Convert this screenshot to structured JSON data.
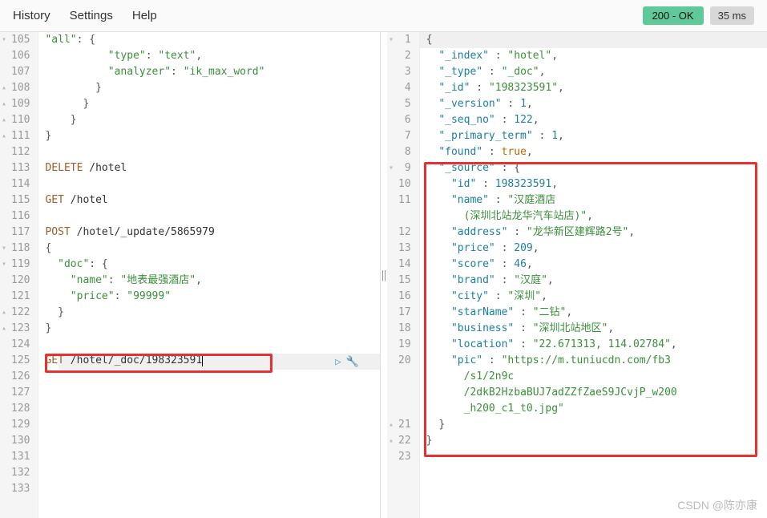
{
  "menu": {
    "history": "History",
    "settings": "Settings",
    "help": "Help"
  },
  "status": {
    "code": "200 - OK",
    "time": "35 ms"
  },
  "left": {
    "lines": [
      {
        "n": "105",
        "fold": "▾",
        "t": "        \"all\": {",
        "tokens": [
          {
            "c": "str",
            "t": "\"all\""
          },
          {
            "c": "punc",
            "t": ": {"
          }
        ]
      },
      {
        "n": "106",
        "t": "          \"type\": \"text\",",
        "tokens": [
          {
            "c": "",
            "t": "          "
          },
          {
            "c": "str",
            "t": "\"type\""
          },
          {
            "c": "punc",
            "t": ": "
          },
          {
            "c": "str",
            "t": "\"text\""
          },
          {
            "c": "punc",
            "t": ","
          }
        ]
      },
      {
        "n": "107",
        "t": "          \"analyzer\": \"ik_max_word\"",
        "tokens": [
          {
            "c": "",
            "t": "          "
          },
          {
            "c": "str",
            "t": "\"analyzer\""
          },
          {
            "c": "punc",
            "t": ": "
          },
          {
            "c": "str",
            "t": "\"ik_max_word\""
          }
        ]
      },
      {
        "n": "108",
        "fold": "▴",
        "t": "        }",
        "tokens": [
          {
            "c": "",
            "t": "        "
          },
          {
            "c": "punc",
            "t": "}"
          }
        ]
      },
      {
        "n": "109",
        "fold": "▴",
        "t": "      }",
        "tokens": [
          {
            "c": "",
            "t": "      "
          },
          {
            "c": "punc",
            "t": "}"
          }
        ]
      },
      {
        "n": "110",
        "fold": "▴",
        "t": "    }",
        "tokens": [
          {
            "c": "",
            "t": "    "
          },
          {
            "c": "punc",
            "t": "}"
          }
        ]
      },
      {
        "n": "111",
        "fold": "▴",
        "t": "}",
        "tokens": [
          {
            "c": "punc",
            "t": "}"
          }
        ]
      },
      {
        "n": "112",
        "t": "",
        "tokens": []
      },
      {
        "n": "113",
        "t": "DELETE /hotel",
        "tokens": [
          {
            "c": "kw",
            "t": "DELETE"
          },
          {
            "c": "",
            "t": " /hotel"
          }
        ]
      },
      {
        "n": "114",
        "t": "",
        "tokens": []
      },
      {
        "n": "115",
        "t": "GET /hotel",
        "tokens": [
          {
            "c": "kw",
            "t": "GET"
          },
          {
            "c": "",
            "t": " /hotel"
          }
        ]
      },
      {
        "n": "116",
        "t": "",
        "tokens": []
      },
      {
        "n": "117",
        "t": "POST /hotel/_update/5865979",
        "tokens": [
          {
            "c": "kw",
            "t": "POST"
          },
          {
            "c": "",
            "t": " /hotel/_update/5865979"
          }
        ]
      },
      {
        "n": "118",
        "fold": "▾",
        "t": "{",
        "tokens": [
          {
            "c": "punc",
            "t": "{"
          }
        ]
      },
      {
        "n": "119",
        "fold": "▾",
        "t": "  \"doc\": {",
        "tokens": [
          {
            "c": "",
            "t": "  "
          },
          {
            "c": "str",
            "t": "\"doc\""
          },
          {
            "c": "punc",
            "t": ": {"
          }
        ]
      },
      {
        "n": "120",
        "t": "    \"name\": \"地表最强酒店\",",
        "tokens": [
          {
            "c": "",
            "t": "    "
          },
          {
            "c": "str",
            "t": "\"name\""
          },
          {
            "c": "punc",
            "t": ": "
          },
          {
            "c": "str",
            "t": "\"地表最强酒店\""
          },
          {
            "c": "punc",
            "t": ","
          }
        ]
      },
      {
        "n": "121",
        "t": "    \"price\": \"99999\"",
        "tokens": [
          {
            "c": "",
            "t": "    "
          },
          {
            "c": "str",
            "t": "\"price\""
          },
          {
            "c": "punc",
            "t": ": "
          },
          {
            "c": "str",
            "t": "\"99999\""
          }
        ]
      },
      {
        "n": "122",
        "fold": "▴",
        "t": "  }",
        "tokens": [
          {
            "c": "",
            "t": "  "
          },
          {
            "c": "punc",
            "t": "}"
          }
        ]
      },
      {
        "n": "123",
        "fold": "▴",
        "t": "}",
        "tokens": [
          {
            "c": "punc",
            "t": "}"
          }
        ]
      },
      {
        "n": "124",
        "t": "",
        "tokens": []
      },
      {
        "n": "125",
        "t": "GET /hotel/_doc/198323591",
        "tokens": [
          {
            "c": "kw",
            "t": "GET"
          },
          {
            "c": "",
            "t": " /hotel/_doc/198323591"
          }
        ],
        "cursor": true
      },
      {
        "n": "126",
        "t": "",
        "tokens": []
      },
      {
        "n": "127",
        "t": "",
        "tokens": []
      },
      {
        "n": "128",
        "t": "",
        "tokens": []
      },
      {
        "n": "129",
        "t": "",
        "tokens": []
      },
      {
        "n": "130",
        "t": "",
        "tokens": []
      },
      {
        "n": "131",
        "t": "",
        "tokens": []
      },
      {
        "n": "132",
        "t": "",
        "tokens": []
      },
      {
        "n": "133",
        "t": "",
        "tokens": []
      }
    ]
  },
  "right": {
    "lines": [
      {
        "n": "1",
        "fold": "▾",
        "tokens": [
          {
            "c": "punc",
            "t": "{"
          }
        ]
      },
      {
        "n": "2",
        "tokens": [
          {
            "c": "",
            "t": "  "
          },
          {
            "c": "key",
            "t": "\"_index\""
          },
          {
            "c": "punc",
            "t": " : "
          },
          {
            "c": "str",
            "t": "\"hotel\""
          },
          {
            "c": "punc",
            "t": ","
          }
        ]
      },
      {
        "n": "3",
        "tokens": [
          {
            "c": "",
            "t": "  "
          },
          {
            "c": "key",
            "t": "\"_type\""
          },
          {
            "c": "punc",
            "t": " : "
          },
          {
            "c": "str",
            "t": "\"_doc\""
          },
          {
            "c": "punc",
            "t": ","
          }
        ]
      },
      {
        "n": "4",
        "tokens": [
          {
            "c": "",
            "t": "  "
          },
          {
            "c": "key",
            "t": "\"_id\""
          },
          {
            "c": "punc",
            "t": " : "
          },
          {
            "c": "str",
            "t": "\"198323591\""
          },
          {
            "c": "punc",
            "t": ","
          }
        ]
      },
      {
        "n": "5",
        "tokens": [
          {
            "c": "",
            "t": "  "
          },
          {
            "c": "key",
            "t": "\"_version\""
          },
          {
            "c": "punc",
            "t": " : "
          },
          {
            "c": "num",
            "t": "1"
          },
          {
            "c": "punc",
            "t": ","
          }
        ]
      },
      {
        "n": "6",
        "tokens": [
          {
            "c": "",
            "t": "  "
          },
          {
            "c": "key",
            "t": "\"_seq_no\""
          },
          {
            "c": "punc",
            "t": " : "
          },
          {
            "c": "num",
            "t": "122"
          },
          {
            "c": "punc",
            "t": ","
          }
        ]
      },
      {
        "n": "7",
        "tokens": [
          {
            "c": "",
            "t": "  "
          },
          {
            "c": "key",
            "t": "\"_primary_term\""
          },
          {
            "c": "punc",
            "t": " : "
          },
          {
            "c": "num",
            "t": "1"
          },
          {
            "c": "punc",
            "t": ","
          }
        ]
      },
      {
        "n": "8",
        "tokens": [
          {
            "c": "",
            "t": "  "
          },
          {
            "c": "key",
            "t": "\"found\""
          },
          {
            "c": "punc",
            "t": " : "
          },
          {
            "c": "bool",
            "t": "true"
          },
          {
            "c": "punc",
            "t": ","
          }
        ]
      },
      {
        "n": "9",
        "fold": "▾",
        "tokens": [
          {
            "c": "",
            "t": "  "
          },
          {
            "c": "key",
            "t": "\"_source\""
          },
          {
            "c": "punc",
            "t": " : {"
          }
        ]
      },
      {
        "n": "10",
        "tokens": [
          {
            "c": "",
            "t": "    "
          },
          {
            "c": "key",
            "t": "\"id\""
          },
          {
            "c": "punc",
            "t": " : "
          },
          {
            "c": "num",
            "t": "198323591"
          },
          {
            "c": "punc",
            "t": ","
          }
        ]
      },
      {
        "n": "11",
        "tokens": [
          {
            "c": "",
            "t": "    "
          },
          {
            "c": "key",
            "t": "\"name\""
          },
          {
            "c": "punc",
            "t": " : "
          },
          {
            "c": "str",
            "t": "\"汉庭酒店"
          }
        ]
      },
      {
        "n": "",
        "tokens": [
          {
            "c": "",
            "t": "      "
          },
          {
            "c": "str",
            "t": "(深圳北站龙华汽车站店)\""
          },
          {
            "c": "punc",
            "t": ","
          }
        ]
      },
      {
        "n": "12",
        "tokens": [
          {
            "c": "",
            "t": "    "
          },
          {
            "c": "key",
            "t": "\"address\""
          },
          {
            "c": "punc",
            "t": " : "
          },
          {
            "c": "str",
            "t": "\"龙华新区建辉路2号\""
          },
          {
            "c": "punc",
            "t": ","
          }
        ]
      },
      {
        "n": "13",
        "tokens": [
          {
            "c": "",
            "t": "    "
          },
          {
            "c": "key",
            "t": "\"price\""
          },
          {
            "c": "punc",
            "t": " : "
          },
          {
            "c": "num",
            "t": "209"
          },
          {
            "c": "punc",
            "t": ","
          }
        ]
      },
      {
        "n": "14",
        "tokens": [
          {
            "c": "",
            "t": "    "
          },
          {
            "c": "key",
            "t": "\"score\""
          },
          {
            "c": "punc",
            "t": " : "
          },
          {
            "c": "num",
            "t": "46"
          },
          {
            "c": "punc",
            "t": ","
          }
        ]
      },
      {
        "n": "15",
        "tokens": [
          {
            "c": "",
            "t": "    "
          },
          {
            "c": "key",
            "t": "\"brand\""
          },
          {
            "c": "punc",
            "t": " : "
          },
          {
            "c": "str",
            "t": "\"汉庭\""
          },
          {
            "c": "punc",
            "t": ","
          }
        ]
      },
      {
        "n": "16",
        "tokens": [
          {
            "c": "",
            "t": "    "
          },
          {
            "c": "key",
            "t": "\"city\""
          },
          {
            "c": "punc",
            "t": " : "
          },
          {
            "c": "str",
            "t": "\"深圳\""
          },
          {
            "c": "punc",
            "t": ","
          }
        ]
      },
      {
        "n": "17",
        "tokens": [
          {
            "c": "",
            "t": "    "
          },
          {
            "c": "key",
            "t": "\"starName\""
          },
          {
            "c": "punc",
            "t": " : "
          },
          {
            "c": "str",
            "t": "\"二钻\""
          },
          {
            "c": "punc",
            "t": ","
          }
        ]
      },
      {
        "n": "18",
        "tokens": [
          {
            "c": "",
            "t": "    "
          },
          {
            "c": "key",
            "t": "\"business\""
          },
          {
            "c": "punc",
            "t": " : "
          },
          {
            "c": "str",
            "t": "\"深圳北站地区\""
          },
          {
            "c": "punc",
            "t": ","
          }
        ]
      },
      {
        "n": "19",
        "tokens": [
          {
            "c": "",
            "t": "    "
          },
          {
            "c": "key",
            "t": "\"location\""
          },
          {
            "c": "punc",
            "t": " : "
          },
          {
            "c": "str",
            "t": "\"22.671313, 114.02784\""
          },
          {
            "c": "punc",
            "t": ","
          }
        ]
      },
      {
        "n": "20",
        "tokens": [
          {
            "c": "",
            "t": "    "
          },
          {
            "c": "key",
            "t": "\"pic\""
          },
          {
            "c": "punc",
            "t": " : "
          },
          {
            "c": "str",
            "t": "\"https://m.tuniucdn.com/fb3"
          }
        ]
      },
      {
        "n": "",
        "tokens": [
          {
            "c": "",
            "t": "      "
          },
          {
            "c": "str",
            "t": "/s1/2n9c"
          }
        ]
      },
      {
        "n": "",
        "tokens": [
          {
            "c": "",
            "t": "      "
          },
          {
            "c": "str",
            "t": "/2dkB2HzbaBUJ7adZZfZaeS9JCvjP_w200"
          }
        ]
      },
      {
        "n": "",
        "tokens": [
          {
            "c": "",
            "t": "      "
          },
          {
            "c": "str",
            "t": "_h200_c1_t0.jpg\""
          }
        ]
      },
      {
        "n": "21",
        "fold": "▴",
        "tokens": [
          {
            "c": "",
            "t": "  "
          },
          {
            "c": "punc",
            "t": "}"
          }
        ]
      },
      {
        "n": "22",
        "fold": "▴",
        "tokens": [
          {
            "c": "punc",
            "t": "}"
          }
        ]
      },
      {
        "n": "23",
        "tokens": []
      }
    ]
  },
  "watermark": "CSDN @陈亦康",
  "run_icon": "▷",
  "wrench_icon": "🔧"
}
